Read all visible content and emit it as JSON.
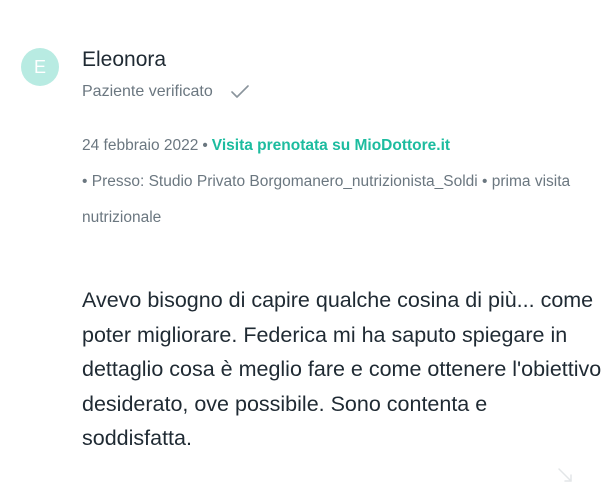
{
  "review": {
    "avatar_initial": "E",
    "author_name": "Eleonora",
    "verified_label": "Paziente verificato",
    "date": "24 febbraio 2022",
    "separator": "•",
    "booking_label": "Visita prenotata su MioDottore.it",
    "location_prefix": "• Presso:",
    "location": "Studio Privato Borgomanero_nutrizionista_Soldi",
    "visit_type": "• prima visita nutrizionale",
    "text": "Avevo bisogno di capire qualche cosina di più... come poter migliorare. Federica mi ha saputo spiegare in dettaglio cosa è meglio fare e come ottenere l'obiettivo desiderato, ove possibile. Sono contenta e soddisfatta."
  },
  "colors": {
    "accent": "#1dbc9f",
    "avatar_bg": "#b8ebe2",
    "muted_text": "#6b7780",
    "body_text": "#1f2a33"
  },
  "icons": {
    "verified": "check-icon",
    "corner": "chevron-icon"
  }
}
